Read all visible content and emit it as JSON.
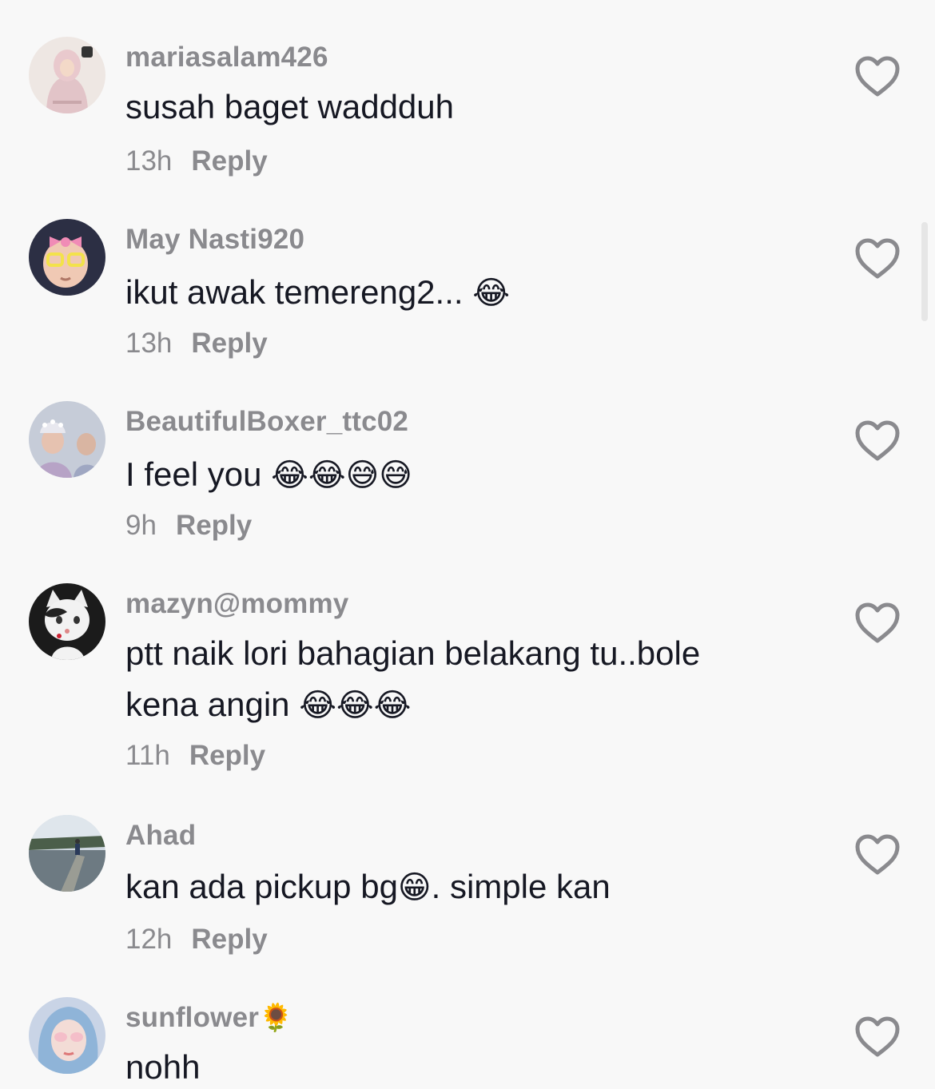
{
  "comments": [
    {
      "username": "mariasalam426",
      "text": "susah baget waddduh",
      "emojis": "",
      "time": "13h",
      "reply": "Reply",
      "avatar_icon": "hijab-woman-avatar"
    },
    {
      "username": "May Nasti920",
      "text": "ikut awak temereng2... ",
      "emojis": "😂",
      "time": "13h",
      "reply": "Reply",
      "avatar_icon": "baby-pink-bow-avatar"
    },
    {
      "username": "BeautifulBoxer_ttc02",
      "text": "I feel you ",
      "emojis": "😂😂😅😅",
      "time": "9h",
      "reply": "Reply",
      "avatar_icon": "woman-headdress-avatar"
    },
    {
      "username": "mazyn@mommy",
      "text": "ptt naik lori bahagian belakang tu..bole",
      "text_line2": "kena angin ",
      "emojis": "😂😂😂",
      "time": "11h",
      "reply": "Reply",
      "avatar_icon": "cat-avatar"
    },
    {
      "username": "Ahad",
      "text": "kan ada pickup bg",
      "emojis": "😁",
      "text_after": ". simple kan",
      "time": "12h",
      "reply": "Reply",
      "avatar_icon": "lakeside-avatar"
    },
    {
      "username": "sunflower",
      "username_emoji": "🌻",
      "text": "nohh",
      "emojis": "",
      "avatar_icon": "blue-hair-girl-avatar"
    }
  ],
  "colors": {
    "background": "#f8f8f8",
    "username": "#8a8a8e",
    "text": "#161823",
    "heart_outline": "#8a8a8e"
  },
  "icons": {
    "like": "heart-outline-icon"
  }
}
